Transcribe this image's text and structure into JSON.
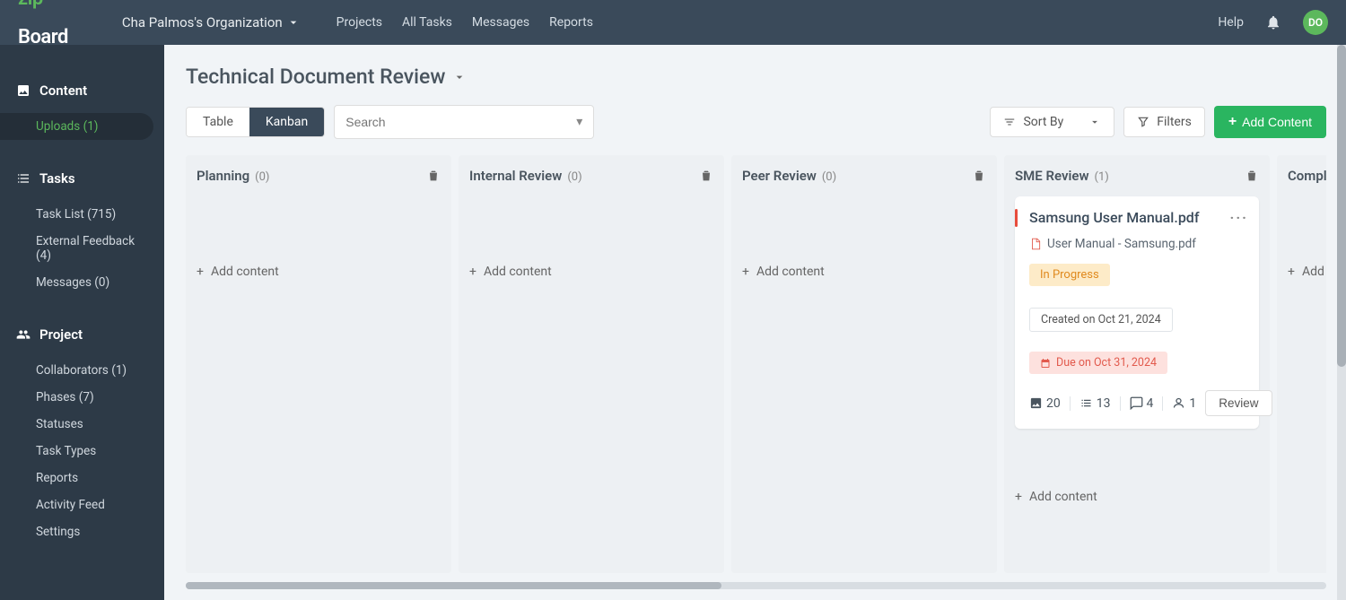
{
  "brand": {
    "zip": "zip",
    "board": "Board"
  },
  "org_name": "Cha Palmos's Organization",
  "topnav": {
    "projects": "Projects",
    "all_tasks": "All Tasks",
    "messages": "Messages",
    "reports": "Reports"
  },
  "help": "Help",
  "avatar": "DO",
  "sidebar": {
    "content": {
      "heading": "Content",
      "uploads": "Uploads (1)"
    },
    "tasks": {
      "heading": "Tasks",
      "task_list": "Task List (715)",
      "external_feedback": "External Feedback (4)",
      "messages": "Messages (0)"
    },
    "project": {
      "heading": "Project",
      "collaborators": "Collaborators (1)",
      "phases": "Phases (7)",
      "statuses": "Statuses",
      "task_types": "Task Types",
      "reports": "Reports",
      "activity_feed": "Activity Feed",
      "settings": "Settings"
    }
  },
  "page_title": "Technical Document Review",
  "views": {
    "table": "Table",
    "kanban": "Kanban"
  },
  "search_placeholder": "Search",
  "sort_by": "Sort By",
  "filters": "Filters",
  "add_content": "Add Content",
  "columns": {
    "planning": {
      "title": "Planning",
      "count": "(0)",
      "add": "Add content"
    },
    "internal": {
      "title": "Internal Review",
      "count": "(0)",
      "add": "Add content"
    },
    "peer": {
      "title": "Peer Review",
      "count": "(0)",
      "add": "Add content"
    },
    "sme": {
      "title": "SME Review",
      "count": "(1)",
      "add": "Add content"
    },
    "compliance": {
      "title": "Complian",
      "add": "Add co"
    }
  },
  "card": {
    "title": "Samsung User Manual.pdf",
    "file": "User Manual - Samsung.pdf",
    "status": "In Progress",
    "created": "Created on Oct 21, 2024",
    "due": "Due on Oct 31, 2024",
    "stat_images": "20",
    "stat_tasks": "13",
    "stat_comments": "4",
    "stat_users": "1",
    "review": "Review"
  }
}
